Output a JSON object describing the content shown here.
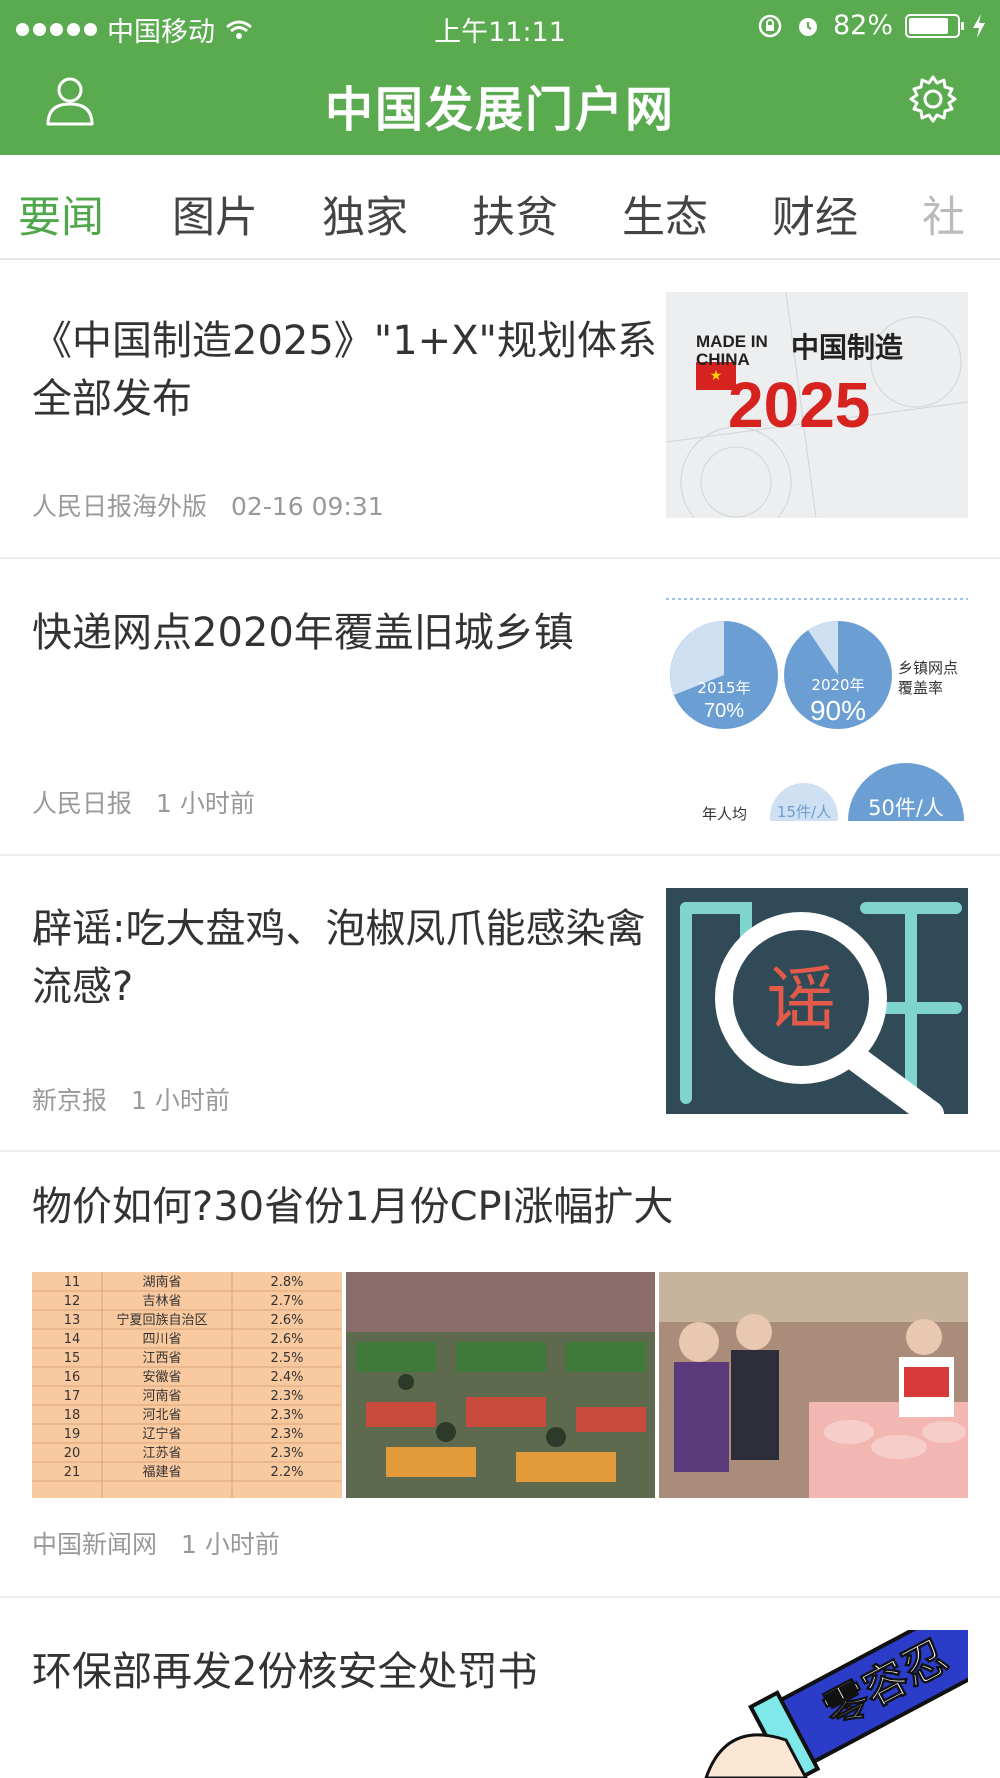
{
  "status_bar": {
    "carrier": "中国移动",
    "time": "上午11:11",
    "battery": "82%",
    "battery_level": 0.82
  },
  "navbar": {
    "title": "中国发展门户网"
  },
  "tabs": [
    {
      "label": "要闻",
      "active": true
    },
    {
      "label": "图片"
    },
    {
      "label": "独家"
    },
    {
      "label": "扶贫"
    },
    {
      "label": "生态"
    },
    {
      "label": "财经"
    },
    {
      "label": "社"
    }
  ],
  "feed": [
    {
      "title": "《中国制造2025》\"1+X\"规划体系全部发布",
      "source": "人民日报海外版",
      "time": "02-16 09:31",
      "thumb": {
        "line1": "MADE IN",
        "line2": "CHINA",
        "cn": "中国制造",
        "year": "2025"
      }
    },
    {
      "title": "快递网点2020年覆盖旧城乡镇",
      "source": "人民日报",
      "time": "1 小时前",
      "thumb": {
        "y1": "2015年",
        "p1": "70%",
        "y2": "2020年",
        "p2": "90%",
        "legend": "乡镇网点覆盖率",
        "bottom_left": "年人均",
        "bottom_mid": "15件/人",
        "bottom_right": "50件/人"
      }
    },
    {
      "title": "辟谣:吃大盘鸡、泡椒凤爪能感染禽流感?",
      "source": "新京报",
      "time": "1 小时前",
      "thumb": {
        "char": "谣"
      }
    },
    {
      "title": "物价如何?30省份1月份CPI涨幅扩大",
      "source": "中国新闻网",
      "time": "1 小时前",
      "table_rows": [
        [
          "11",
          "湖南省",
          "2.8%"
        ],
        [
          "12",
          "吉林省",
          "2.7%"
        ],
        [
          "13",
          "宁夏回族自治区",
          "2.6%"
        ],
        [
          "14",
          "四川省",
          "2.6%"
        ],
        [
          "15",
          "江西省",
          "2.5%"
        ],
        [
          "16",
          "安徽省",
          "2.4%"
        ],
        [
          "17",
          "河南省",
          "2.3%"
        ],
        [
          "18",
          "河北省",
          "2.3%"
        ],
        [
          "19",
          "辽宁省",
          "2.3%"
        ],
        [
          "20",
          "江苏省",
          "2.3%"
        ],
        [
          "21",
          "福建省",
          "2.2%"
        ]
      ]
    },
    {
      "title": "环保部再发2份核安全处罚书",
      "thumb": {
        "text": "零容忍"
      }
    }
  ],
  "colors": {
    "brand_green": "#5aaa4f",
    "active_tab": "#4fa64b"
  }
}
